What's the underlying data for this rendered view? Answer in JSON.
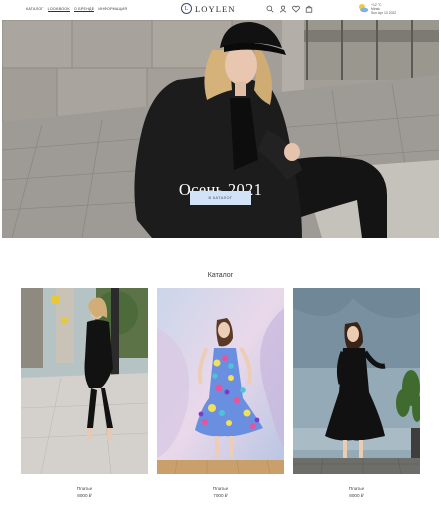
{
  "nav": {
    "items": [
      {
        "label": "КАТАЛОГ",
        "underlined": false
      },
      {
        "label": "LOOKBOOK",
        "underlined": true
      },
      {
        "label": "О БРЕНДЕ",
        "underlined": true
      },
      {
        "label": "ИНФОРМАЦИЯ",
        "underlined": false
      }
    ]
  },
  "logo": {
    "mark": "L",
    "text": "LOYLEN"
  },
  "header_icons": [
    "search-icon",
    "user-icon",
    "heart-icon",
    "bag-icon"
  ],
  "weather": {
    "line1": "+12 °C",
    "line2": "Minsk",
    "line3": "Sun Apr 10 2022"
  },
  "hero": {
    "title": "Осень 2021",
    "button_label": "В КАТАЛОГ"
  },
  "catalog": {
    "title": "Каталог",
    "products": [
      {
        "name": "Платье",
        "price": "8000 ₽"
      },
      {
        "name": "Платье",
        "price": "7000 ₽"
      },
      {
        "name": "Платье",
        "price": "8000 ₽"
      }
    ]
  },
  "colors": {
    "button_bg": "#d3e3f7",
    "logo_accent": "#3b4a7a",
    "text": "#2a2a2a"
  }
}
